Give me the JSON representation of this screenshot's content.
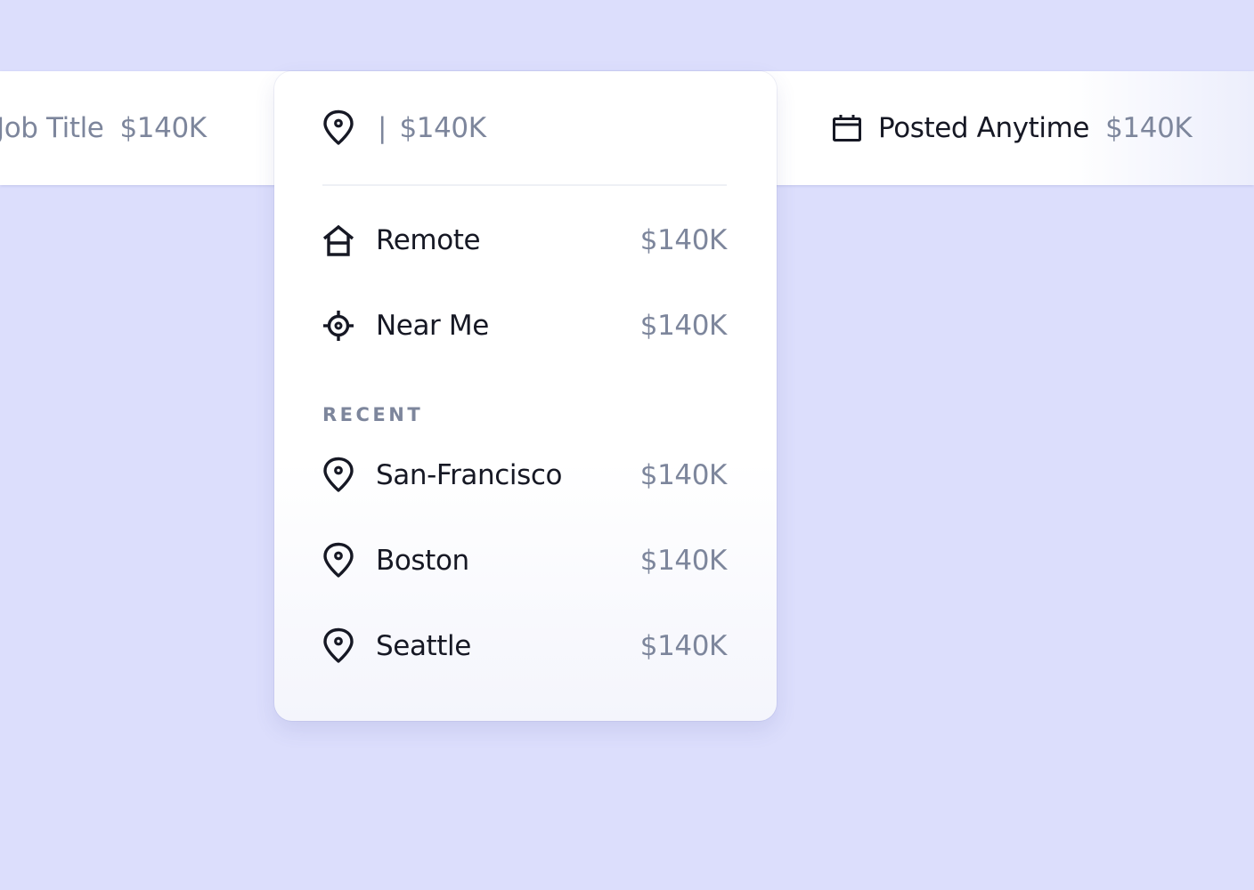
{
  "search_bar": {
    "job_title": {
      "label": "Job Title",
      "salary": "$140K"
    },
    "location": {
      "caret": "|",
      "salary": "$140K"
    },
    "date": {
      "label": "Posted Anytime",
      "salary": "$140K",
      "icon": "calendar-icon"
    }
  },
  "dropdown": {
    "input_icon": "location-pin-icon",
    "options": [
      {
        "label": "Remote",
        "salary": "$140K",
        "icon": "home-icon"
      },
      {
        "label": "Near Me",
        "salary": "$140K",
        "icon": "crosshair-icon"
      }
    ],
    "recent_heading": "RECENT",
    "recent": [
      {
        "label": "San-Francisco",
        "salary": "$140K",
        "icon": "location-pin-icon"
      },
      {
        "label": "Boston",
        "salary": "$140K",
        "icon": "location-pin-icon"
      },
      {
        "label": "Seattle",
        "salary": "$140K",
        "icon": "location-pin-icon"
      }
    ]
  },
  "colors": {
    "background": "#dcdefc",
    "text_dark": "#161824",
    "text_muted": "#7d869c"
  }
}
